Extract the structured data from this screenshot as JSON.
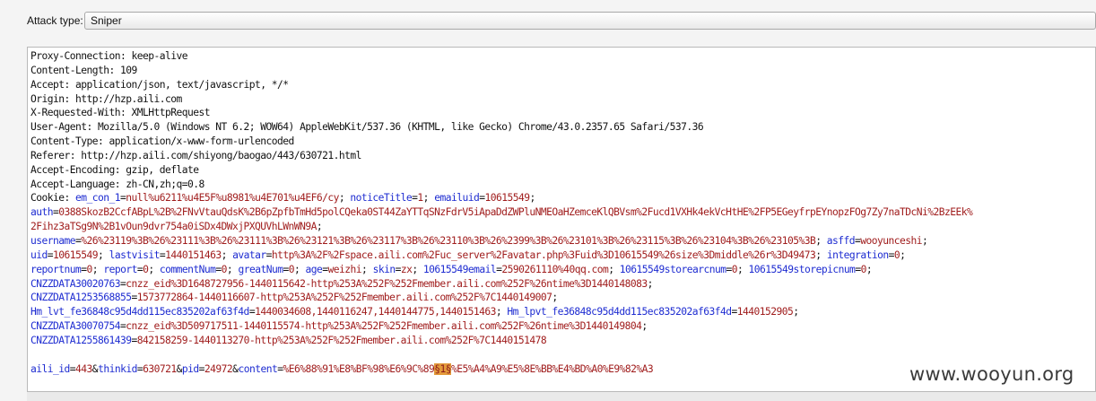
{
  "attack": {
    "label": "Attack type:",
    "value": "Sniper"
  },
  "headers": [
    "Proxy-Connection: keep-alive",
    "Content-Length: 109",
    "Accept: application/json, text/javascript, */*",
    "Origin: http://hzp.aili.com",
    "X-Requested-With: XMLHttpRequest",
    "User-Agent: Mozilla/5.0 (Windows NT 6.2; WOW64) AppleWebKit/537.36 (KHTML, like Gecko) Chrome/43.0.2357.65 Safari/537.36",
    "Content-Type: application/x-www-form-urlencoded",
    "Referer: http://hzp.aili.com/shiyong/baogao/443/630721.html",
    "Accept-Encoding: gzip, deflate",
    "Accept-Language: zh-CN,zh;q=0.8"
  ],
  "cookie_prefix": "Cookie: ",
  "cookie_lines": [
    [
      {
        "t": "k",
        "s": "em_con_1"
      },
      {
        "t": "p",
        "s": "="
      },
      {
        "t": "v",
        "s": "null%u6211%u4E5F%u8981%u4E701%u4EF6/cy"
      },
      {
        "t": "p",
        "s": "; "
      },
      {
        "t": "k",
        "s": "noticeTitle"
      },
      {
        "t": "p",
        "s": "="
      },
      {
        "t": "v",
        "s": "1"
      },
      {
        "t": "p",
        "s": "; "
      },
      {
        "t": "k",
        "s": "emailuid"
      },
      {
        "t": "p",
        "s": "="
      },
      {
        "t": "v",
        "s": "10615549"
      },
      {
        "t": "p",
        "s": ";"
      }
    ],
    [
      {
        "t": "k",
        "s": "auth"
      },
      {
        "t": "p",
        "s": "="
      },
      {
        "t": "v",
        "s": "0388SkozB2CcfABpL%2B%2FNvVtauQdsK%2B6pZpfbTmHd5polCQeka0ST44ZaYTTqSNzFdrV5iApaDdZWPluNMEOaHZemceKlQBVsm%2Fucd1VXHk4ekVcHtHE%2FP5EGeyfrpEYnopzFOg7Zy7naTDcNi%2BzEEk%"
      }
    ],
    [
      {
        "t": "v",
        "s": "2Fihz3aTSg9N%2B1vOun9dvr754a0iSDx4DWxjPXQUVhLWnWN9A"
      },
      {
        "t": "p",
        "s": ";"
      }
    ],
    [
      {
        "t": "k",
        "s": "username"
      },
      {
        "t": "p",
        "s": "="
      },
      {
        "t": "v",
        "s": "%26%23119%3B%26%23111%3B%26%23111%3B%26%23121%3B%26%23117%3B%26%23110%3B%26%2399%3B%26%23101%3B%26%23115%3B%26%23104%3B%26%23105%3B"
      },
      {
        "t": "p",
        "s": "; "
      },
      {
        "t": "k",
        "s": "asffd"
      },
      {
        "t": "p",
        "s": "="
      },
      {
        "t": "v",
        "s": "wooyunceshi"
      },
      {
        "t": "p",
        "s": ";"
      }
    ],
    [
      {
        "t": "k",
        "s": "uid"
      },
      {
        "t": "p",
        "s": "="
      },
      {
        "t": "v",
        "s": "10615549"
      },
      {
        "t": "p",
        "s": "; "
      },
      {
        "t": "k",
        "s": "lastvisit"
      },
      {
        "t": "p",
        "s": "="
      },
      {
        "t": "v",
        "s": "1440151463"
      },
      {
        "t": "p",
        "s": "; "
      },
      {
        "t": "k",
        "s": "avatar"
      },
      {
        "t": "p",
        "s": "="
      },
      {
        "t": "v",
        "s": "http%3A%2F%2Fspace.aili.com%2Fuc_server%2Favatar.php%3Fuid%3D10615549%26size%3Dmiddle%26r%3D49473"
      },
      {
        "t": "p",
        "s": "; "
      },
      {
        "t": "k",
        "s": "integration"
      },
      {
        "t": "p",
        "s": "="
      },
      {
        "t": "v",
        "s": "0"
      },
      {
        "t": "p",
        "s": ";"
      }
    ],
    [
      {
        "t": "k",
        "s": "reportnum"
      },
      {
        "t": "p",
        "s": "="
      },
      {
        "t": "v",
        "s": "0"
      },
      {
        "t": "p",
        "s": "; "
      },
      {
        "t": "k",
        "s": "report"
      },
      {
        "t": "p",
        "s": "="
      },
      {
        "t": "v",
        "s": "0"
      },
      {
        "t": "p",
        "s": "; "
      },
      {
        "t": "k",
        "s": "commentNum"
      },
      {
        "t": "p",
        "s": "="
      },
      {
        "t": "v",
        "s": "0"
      },
      {
        "t": "p",
        "s": "; "
      },
      {
        "t": "k",
        "s": "greatNum"
      },
      {
        "t": "p",
        "s": "="
      },
      {
        "t": "v",
        "s": "0"
      },
      {
        "t": "p",
        "s": "; "
      },
      {
        "t": "k",
        "s": "age"
      },
      {
        "t": "p",
        "s": "="
      },
      {
        "t": "v",
        "s": "weizhi"
      },
      {
        "t": "p",
        "s": "; "
      },
      {
        "t": "k",
        "s": "skin"
      },
      {
        "t": "p",
        "s": "="
      },
      {
        "t": "v",
        "s": "zx"
      },
      {
        "t": "p",
        "s": "; "
      },
      {
        "t": "k",
        "s": "10615549email"
      },
      {
        "t": "p",
        "s": "="
      },
      {
        "t": "v",
        "s": "2590261110%40qq.com"
      },
      {
        "t": "p",
        "s": "; "
      },
      {
        "t": "k",
        "s": "10615549storearcnum"
      },
      {
        "t": "p",
        "s": "="
      },
      {
        "t": "v",
        "s": "0"
      },
      {
        "t": "p",
        "s": "; "
      },
      {
        "t": "k",
        "s": "10615549storepicnum"
      },
      {
        "t": "p",
        "s": "="
      },
      {
        "t": "v",
        "s": "0"
      },
      {
        "t": "p",
        "s": ";"
      }
    ],
    [
      {
        "t": "k",
        "s": "CNZZDATA30020763"
      },
      {
        "t": "p",
        "s": "="
      },
      {
        "t": "v",
        "s": "cnzz_eid%3D1648727956-1440115642-http%253A%252F%252Fmember.aili.com%252F%26ntime%3D1440148083"
      },
      {
        "t": "p",
        "s": ";"
      }
    ],
    [
      {
        "t": "k",
        "s": "CNZZDATA1253568855"
      },
      {
        "t": "p",
        "s": "="
      },
      {
        "t": "v",
        "s": "1573772864-1440116607-http%253A%252F%252Fmember.aili.com%252F%7C1440149007"
      },
      {
        "t": "p",
        "s": ";"
      }
    ],
    [
      {
        "t": "k",
        "s": "Hm_lvt_fe36848c95d4dd115ec835202af63f4d"
      },
      {
        "t": "p",
        "s": "="
      },
      {
        "t": "v",
        "s": "1440034608,1440116247,1440144775,1440151463"
      },
      {
        "t": "p",
        "s": "; "
      },
      {
        "t": "k",
        "s": "Hm_lpvt_fe36848c95d4dd115ec835202af63f4d"
      },
      {
        "t": "p",
        "s": "="
      },
      {
        "t": "v",
        "s": "1440152905"
      },
      {
        "t": "p",
        "s": ";"
      }
    ],
    [
      {
        "t": "k",
        "s": "CNZZDATA30070754"
      },
      {
        "t": "p",
        "s": "="
      },
      {
        "t": "v",
        "s": "cnzz_eid%3D509717511-1440115574-http%253A%252F%252Fmember.aili.com%252F%26ntime%3D1440149804"
      },
      {
        "t": "p",
        "s": ";"
      }
    ],
    [
      {
        "t": "k",
        "s": "CNZZDATA1255861439"
      },
      {
        "t": "p",
        "s": "="
      },
      {
        "t": "v",
        "s": "842158259-1440113270-http%253A%252F%252Fmember.aili.com%252F%7C1440151478"
      }
    ]
  ],
  "body_line": [
    {
      "t": "k",
      "s": "aili_id"
    },
    {
      "t": "p",
      "s": "="
    },
    {
      "t": "v",
      "s": "443"
    },
    {
      "t": "p",
      "s": "&"
    },
    {
      "t": "k",
      "s": "thinkid"
    },
    {
      "t": "p",
      "s": "="
    },
    {
      "t": "v",
      "s": "630721"
    },
    {
      "t": "p",
      "s": "&"
    },
    {
      "t": "k",
      "s": "pid"
    },
    {
      "t": "p",
      "s": "="
    },
    {
      "t": "v",
      "s": "24972"
    },
    {
      "t": "p",
      "s": "&"
    },
    {
      "t": "k",
      "s": "content"
    },
    {
      "t": "p",
      "s": "="
    },
    {
      "t": "v",
      "s": "%E6%88%91%E8%BF%98%E6%9C%89"
    },
    {
      "t": "m",
      "s": "§1§"
    },
    {
      "t": "v",
      "s": "%E5%A4%A9%E5%8E%BB%E4%BD%A0%E9%82%A3"
    }
  ],
  "watermark": "www.wooyun.org"
}
